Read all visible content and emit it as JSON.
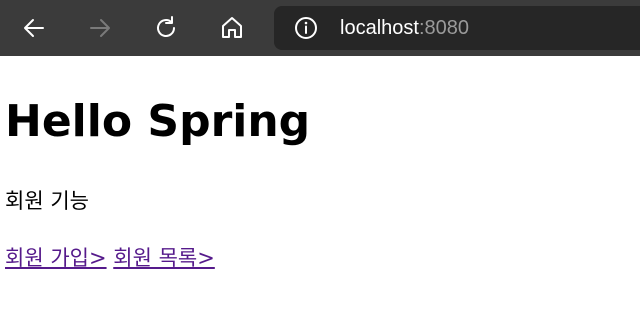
{
  "browser": {
    "url_host": "localhost",
    "url_port": ":8080",
    "icons": {
      "back": "back-arrow-icon",
      "forward": "forward-arrow-icon",
      "refresh": "refresh-icon",
      "home": "home-icon",
      "site_info": "info-icon"
    },
    "colors": {
      "toolbar": "#3b3b3b",
      "address_bar": "#262626",
      "port_text": "#9a9a9a"
    }
  },
  "page": {
    "title": "Hello Spring",
    "section_label": "회원 기능",
    "links": {
      "join": "회원 가입>",
      "list": "회원 목록>"
    },
    "link_color": "#551a8b"
  }
}
